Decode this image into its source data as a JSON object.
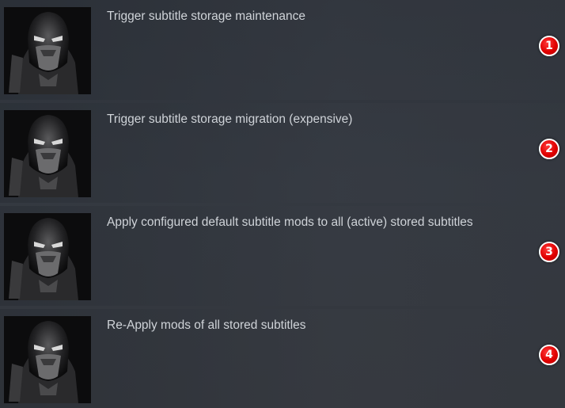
{
  "actions": [
    {
      "label": "Trigger subtitle storage maintenance",
      "badge": "1",
      "thumbnail": "masked-ninja-portrait"
    },
    {
      "label": "Trigger subtitle storage migration (expensive)",
      "badge": "2",
      "thumbnail": "masked-ninja-portrait"
    },
    {
      "label": "Apply configured default subtitle mods to all (active) stored subtitles",
      "badge": "3",
      "thumbnail": "masked-ninja-portrait"
    },
    {
      "label": "Re-Apply mods of all stored subtitles",
      "badge": "4",
      "thumbnail": "masked-ninja-portrait"
    }
  ],
  "colors": {
    "background": "#33373e",
    "title_text": "#cfd3d8",
    "badge_fill": "#e00000",
    "badge_border": "#ffffff"
  }
}
